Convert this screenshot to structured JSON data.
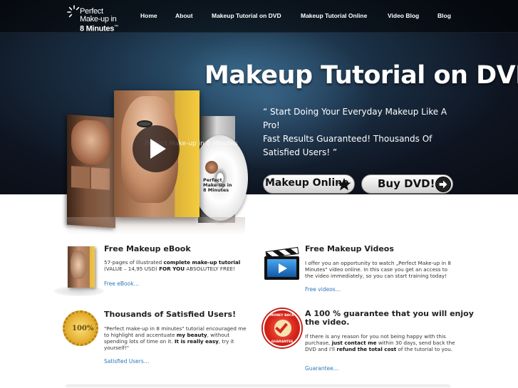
{
  "logo": {
    "line1": "Perfect",
    "line2": "Make-up in",
    "line3": "8 Minutes",
    "tm": "™"
  },
  "nav": {
    "items": [
      {
        "label": "Home"
      },
      {
        "label": "About"
      },
      {
        "label": "Makeup Tutorial on DVD"
      },
      {
        "label": "Makeup Tutorial Online"
      },
      {
        "label": "Video Blog"
      },
      {
        "label": "Blog"
      }
    ]
  },
  "hero": {
    "title": "Makeup Tutorial on DVD",
    "quote_line1": "“ Start Doing Your Everyday Makeup Like A Pro!",
    "quote_line2": "Fast Results Guaranteed! Thousands Of Satisfied Users! ”",
    "product_box_text": "Perfect Make-up in 8 Minutes",
    "disc_text_1": "Perfect",
    "disc_text_2": "Make-up in",
    "disc_text_3": "8 Minutes",
    "buttons": {
      "online_label": "Makeup Online",
      "online_icon": "star-icon",
      "dvd_label": "Buy DVD!",
      "dvd_icon": "arrow-right-icon"
    }
  },
  "features": {
    "ebook": {
      "title": "Free Makeup eBook",
      "body_1": "57-pages of illustrated ",
      "body_2": "complete make-up tutorial",
      "body_3": " (VALUE – 14,95 USD) ",
      "body_4": "FOR YOU",
      "body_5": " ABSOLUTELY FREE!",
      "link": "Free eBook…"
    },
    "videos": {
      "title": "Free Makeup Videos",
      "body": "I offer you an opportunity to watch „Perfect Make-up in 8 Minutes\" video online. In this case you get an access to the video immediately, so you can start training today!",
      "link": "Free videos…"
    },
    "users": {
      "title": "Thousands of Satisfied Users!",
      "body_1": "\"Perfect make-up in 8 minutes\" tutorial encouraged me to highlight and accentuate ",
      "body_2": "my beauty",
      "body_3": ", without spending lots of time on it. ",
      "body_4": "It is really easy",
      "body_5": ", try it yourself!\"",
      "seal_text": "100%",
      "link": "Satisfied Users…"
    },
    "guarantee": {
      "title_line1": "A 100 % guarantee that you will enjoy",
      "title_line2": "the video.",
      "body_1": "If there is any reason for you not being happy with this purchase, ",
      "body_2": "just contact me",
      "body_3": " within 30 days, send back the DVD and I'll ",
      "body_4": "refund the total cost",
      "body_5": " of the tutorial to you.",
      "badge_top": "MONEY BACK",
      "badge_bottom": "GUARANTEE",
      "link": "Guarantee…"
    }
  },
  "colors": {
    "link": "#2b78b8",
    "hero_bg": "#0e1420",
    "badge_red": "#d8261a",
    "seal_gold": "#e8b63a"
  }
}
